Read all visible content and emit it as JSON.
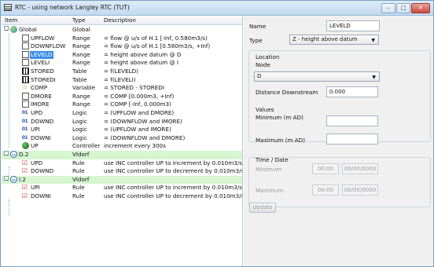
{
  "window": {
    "title": "RTC - using network Langley RTC (TUT)"
  },
  "tree": {
    "headers": {
      "item": "Item",
      "type": "Type",
      "description": "Description"
    },
    "rows": [
      {
        "name": "Global",
        "type": "Global",
        "desc": "",
        "icon": "globe-icon"
      },
      {
        "name": "UPFLOW",
        "type": "Range",
        "desc": "= flow @ u/s of H.1 [-Inf, 0.580m3/s)",
        "icon": "range-icon"
      },
      {
        "name": "DOWNFLOW",
        "type": "Range",
        "desc": "= flow @ u/s of H.1 [0.580m3/s, +Inf)",
        "icon": "range-icon"
      },
      {
        "name": "LEVELD",
        "type": "Range",
        "desc": "= height above datum @ D",
        "icon": "range-icon"
      },
      {
        "name": "LEVELI",
        "type": "Range",
        "desc": "= height above datum @ I",
        "icon": "range-icon"
      },
      {
        "name": "STORED",
        "type": "Table",
        "desc": "= f(LEVELD)",
        "icon": "table-icon"
      },
      {
        "name": "STOREDI",
        "type": "Table",
        "desc": "= f(LEVELI)",
        "icon": "table-icon"
      },
      {
        "name": "COMP",
        "type": "Variable",
        "desc": "= STORED - STOREDI",
        "icon": "star-icon"
      },
      {
        "name": "DMORE",
        "type": "Range",
        "desc": "= COMP [0.000m3, +Inf)",
        "icon": "range-icon"
      },
      {
        "name": "IMORE",
        "type": "Range",
        "desc": "= COMP [-Inf, 0.000m3)",
        "icon": "range-icon"
      },
      {
        "name": "UPD",
        "type": "Logic",
        "desc": "= (UPFLOW and DMORE)",
        "icon": "logic-icon"
      },
      {
        "name": "DOWND",
        "type": "Logic",
        "desc": "= (DOWNFLOW and IMORE)",
        "icon": "logic-icon"
      },
      {
        "name": "UPI",
        "type": "Logic",
        "desc": "= (UPFLOW and IMORE)",
        "icon": "logic-icon"
      },
      {
        "name": "DOWNI",
        "type": "Logic",
        "desc": "= (DOWNFLOW and DMORE)",
        "icon": "logic-icon"
      },
      {
        "name": "UP",
        "type": "Controller",
        "desc": "increment every 300s",
        "icon": "controller-icon"
      },
      {
        "name": "D.2",
        "type": "Vldorf",
        "desc": "",
        "icon": "vldorf-icon"
      },
      {
        "name": "UPD",
        "type": "Rule",
        "desc": "use INC controller UP to increment by 0.010m3/s",
        "icon": "rule-icon"
      },
      {
        "name": "DOWND",
        "type": "Rule",
        "desc": "use INC controller UP to decrement by 0.010m3/s",
        "icon": "rule-icon"
      },
      {
        "name": "I.2",
        "type": "Vldorf",
        "desc": "",
        "icon": "vldorf-icon"
      },
      {
        "name": "UPI",
        "type": "Rule",
        "desc": "use INC controller UP to increment by 0.010m3/s",
        "icon": "rule-icon"
      },
      {
        "name": "DOWNI",
        "type": "Rule",
        "desc": "use INC controller UP to decrement by 0.010m3/s",
        "icon": "rule-icon"
      }
    ]
  },
  "panel": {
    "name_label": "Name",
    "name_value": "LEVELD",
    "type_label": "Type",
    "type_value": "Z - height above datum",
    "location_label": "Location",
    "node_label": "Node",
    "node_value": "D",
    "distance_label": "Distance Downstream",
    "distance_value": "0.000",
    "values_label": "Values",
    "minimum_label": "Minimum (m AD)",
    "minimum_value": "",
    "maximum_label": "Maximum (m AD)",
    "maximum_value": "",
    "timedate_label": "Time / Date",
    "td_minimum_label": "Minimum",
    "td_min_time": "00:00",
    "td_min_date": "00/00/0000",
    "td_maximum_label": "Maximum",
    "td_max_time": "00:00",
    "td_max_date": "00/00/0000",
    "update_label": "Update"
  }
}
